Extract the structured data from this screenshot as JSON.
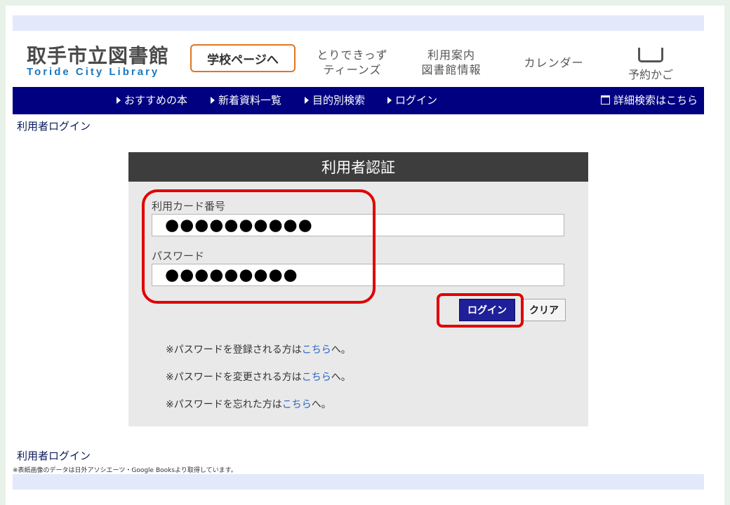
{
  "header": {
    "logo_jp": "取手市立図書館",
    "logo_en": "Toride City Library",
    "school_button": "学校ページへ",
    "links": [
      {
        "line1": "とりできっず",
        "line2": "ティーンズ"
      },
      {
        "line1": "利用案内",
        "line2": "図書館情報"
      },
      {
        "line1": "カレンダー",
        "line2": ""
      }
    ],
    "cart_label": "予約かご",
    "cart_icon": "basket-icon"
  },
  "nav": {
    "items": [
      "おすすめの本",
      "新着資料一覧",
      "目的別検索",
      "ログイン"
    ],
    "advanced_search": "詳細検索はこちら"
  },
  "breadcrumb": "利用者ログイン",
  "login": {
    "title": "利用者認証",
    "card_label": "利用カード番号",
    "card_value": "●●●●●●●●●●",
    "password_label": "パスワード",
    "password_value": "●●●●●●●●●",
    "login_button": "ログイン",
    "clear_button": "クリア",
    "notes": [
      {
        "prefix": "※パスワードを登録される方は",
        "link": "こちら",
        "suffix": "へ。"
      },
      {
        "prefix": "※パスワードを変更される方は",
        "link": "こちら",
        "suffix": "へ。"
      },
      {
        "prefix": "※パスワードを忘れた方は",
        "link": "こちら",
        "suffix": "へ。"
      }
    ]
  },
  "footer": {
    "title": "利用者ログイン",
    "note": "※表紙画像のデータは日外アソシエーツ・Google Booksより取得しています。"
  },
  "colors": {
    "nav_bg": "#000080",
    "highlight": "#e00000",
    "school_border": "#e0761e",
    "link": "#2a64c8"
  }
}
